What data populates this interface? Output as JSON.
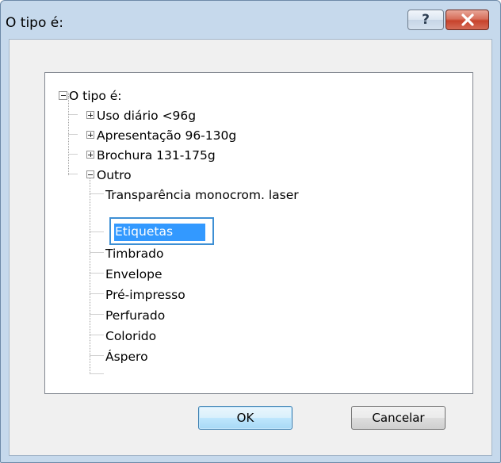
{
  "window": {
    "title": "O tipo é:",
    "help_glyph": "?",
    "buttons": [
      {
        "icon": "help-icon"
      },
      {
        "icon": "close-icon"
      }
    ]
  },
  "tree": {
    "root": {
      "label": "O tipo é:",
      "expander": "minus"
    },
    "groups": [
      {
        "label": "Uso diário <96g",
        "expander": "plus"
      },
      {
        "label": "Apresentação 96-130g",
        "expander": "plus"
      },
      {
        "label": "Brochura 131-175g",
        "expander": "plus"
      },
      {
        "label": "Outro",
        "expander": "minus"
      }
    ],
    "outro_children": [
      "Transparência monocrom. laser",
      "Etiquetas",
      "Timbrado",
      "Envelope",
      "Pré-impresso",
      "Perfurado",
      "Colorido",
      "Áspero"
    ],
    "selected": "Etiquetas"
  },
  "footer": {
    "ok_label": "OK",
    "cancel_label": "Cancelar"
  },
  "colors": {
    "selection": "#3399ff",
    "selection_border": "#3d8fd4",
    "close_button": "#c7432c",
    "frame": "#c6d9ec"
  }
}
